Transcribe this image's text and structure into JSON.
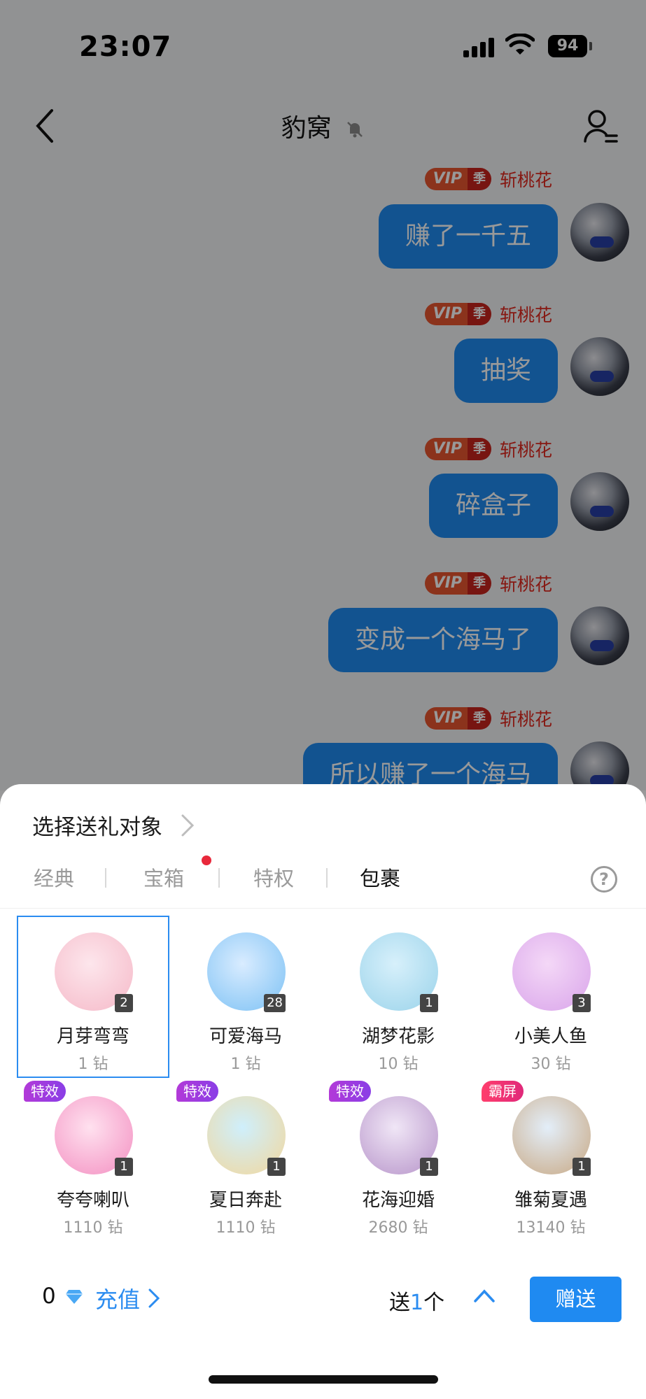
{
  "status_bar": {
    "time": "23:07",
    "battery": "94"
  },
  "nav": {
    "title": "豹窝"
  },
  "messages": [
    {
      "vip": "VIP",
      "season": "季",
      "user": "斩桃花",
      "text": "赚了一千五"
    },
    {
      "vip": "VIP",
      "season": "季",
      "user": "斩桃花",
      "text": "抽奖"
    },
    {
      "vip": "VIP",
      "season": "季",
      "user": "斩桃花",
      "text": "碎盒子"
    },
    {
      "vip": "VIP",
      "season": "季",
      "user": "斩桃花",
      "text": "变成一个海马了"
    },
    {
      "vip": "VIP",
      "season": "季",
      "user": "斩桃花",
      "text": "所以赚了一个海马"
    }
  ],
  "panel": {
    "header": "选择送礼对象",
    "tabs": [
      "经典",
      "宝箱",
      "特权",
      "包裹"
    ],
    "active_tab": "包裹",
    "help": "?",
    "gifts": [
      {
        "name": "月芽弯弯",
        "price": "1 钻",
        "count": "2",
        "tag": "",
        "colors": [
          "#fde6ec",
          "#f5b9c8"
        ]
      },
      {
        "name": "可爱海马",
        "price": "1 钻",
        "count": "28",
        "tag": "",
        "colors": [
          "#d9ecff",
          "#7cc1f4"
        ]
      },
      {
        "name": "湖梦花影",
        "price": "10 钻",
        "count": "1",
        "tag": "",
        "colors": [
          "#d7f0fb",
          "#9ad3ea"
        ]
      },
      {
        "name": "小美人鱼",
        "price": "30 钻",
        "count": "3",
        "tag": "",
        "colors": [
          "#f4d8f7",
          "#d9a4ea"
        ]
      },
      {
        "name": "夸夸喇叭",
        "price": "1110 钻",
        "count": "1",
        "tag": "特效",
        "colors": [
          "#ffe1ef",
          "#f38fc1"
        ]
      },
      {
        "name": "夏日奔赴",
        "price": "1110 钻",
        "count": "1",
        "tag": "特效",
        "colors": [
          "#cfeffc",
          "#f2d79c"
        ]
      },
      {
        "name": "花海迎婚",
        "price": "2680 钻",
        "count": "1",
        "tag": "特效",
        "colors": [
          "#f0e6f6",
          "#b693c9"
        ]
      },
      {
        "name": "雏菊夏遇",
        "price": "13140 钻",
        "count": "1",
        "tag": "霸屏",
        "colors": [
          "#e3eef9",
          "#c8a883"
        ]
      }
    ],
    "balance": "0",
    "recharge": "充值",
    "send_prefix": "送",
    "send_count": "1",
    "send_suffix": "个",
    "gift_button": "赠送"
  }
}
